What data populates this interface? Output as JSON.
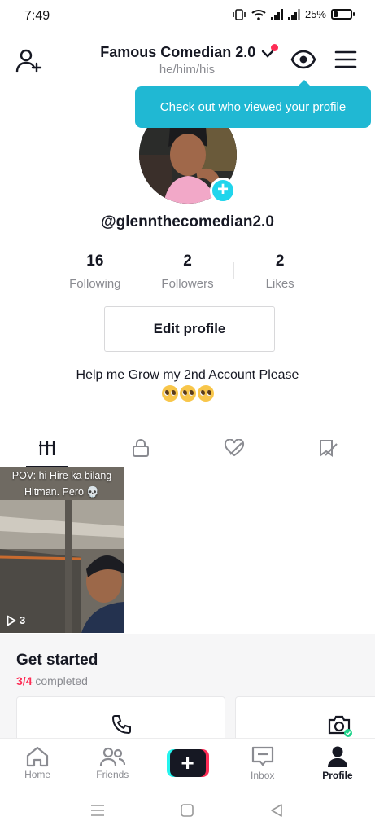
{
  "status_bar": {
    "time": "7:49",
    "battery": "25%",
    "battery_level": 0.25
  },
  "header": {
    "account_name": "Famous Comedian 2.0",
    "pronouns": "he/him/his",
    "has_notification_dot": true
  },
  "tooltip": {
    "text": "Check out who viewed your profile"
  },
  "profile": {
    "username": "@glennthecomedian2.0",
    "stats": [
      {
        "value": "16",
        "label": "Following"
      },
      {
        "value": "2",
        "label": "Followers"
      },
      {
        "value": "2",
        "label": "Likes"
      }
    ],
    "edit_profile_label": "Edit profile",
    "bio": "Help me Grow my 2nd Account Please",
    "bio_emoji": [
      "pleading-face",
      "pleading-face",
      "pleading-face"
    ]
  },
  "tabs": [
    {
      "icon": "grid-icon",
      "active": true
    },
    {
      "icon": "lock-icon",
      "active": false
    },
    {
      "icon": "hidden-heart-icon",
      "active": false
    },
    {
      "icon": "hidden-bookmark-icon",
      "active": false
    }
  ],
  "videos": [
    {
      "caption_line1": "POV: hi Hire ka bilang",
      "caption_line2": "Hitman. Pero 💀",
      "plays": "3"
    }
  ],
  "get_started": {
    "title": "Get started",
    "progress_done": "3",
    "progress_total": "4",
    "progress_suffix": "completed",
    "cards": [
      {
        "icon": "phone-icon"
      },
      {
        "icon": "camera-icon"
      }
    ]
  },
  "bottom_nav": [
    {
      "label": "Home",
      "icon": "home-icon"
    },
    {
      "label": "Friends",
      "icon": "friends-icon"
    },
    {
      "label": "",
      "icon": "create-icon"
    },
    {
      "label": "Inbox",
      "icon": "inbox-icon"
    },
    {
      "label": "Profile",
      "icon": "profile-icon",
      "active": true
    }
  ],
  "colors": {
    "accent": "#fe2c55",
    "tooltip": "#20b8d3",
    "cyan": "#25f4ee"
  }
}
